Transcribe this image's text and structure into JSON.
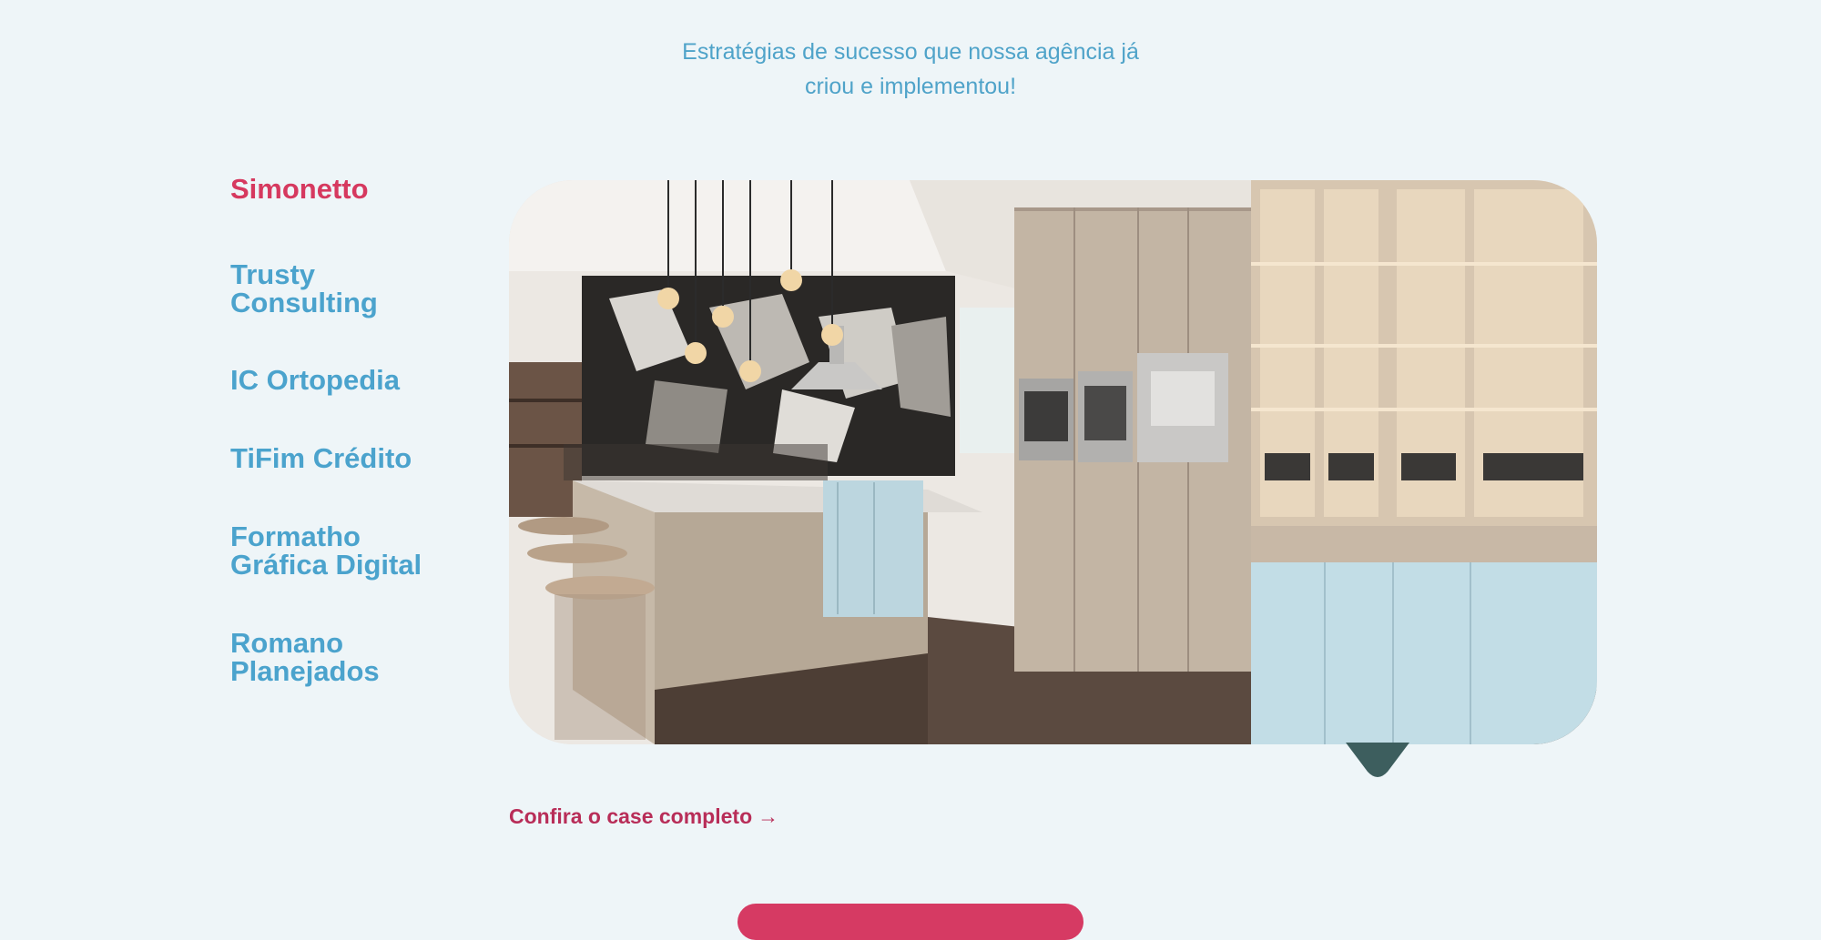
{
  "header": {
    "subtitle_line1": "Estratégias de sucesso que nossa agência já",
    "subtitle_line2": "criou e implementou!"
  },
  "cases": [
    {
      "line1": "Simonetto",
      "line2": "",
      "active": true
    },
    {
      "line1": "Trusty",
      "line2": "Consulting",
      "active": false
    },
    {
      "line1": "IC Ortopedia",
      "line2": "",
      "active": false
    },
    {
      "line1": "TiFim Crédito",
      "line2": "",
      "active": false
    },
    {
      "line1": "Formatho",
      "line2": "Gráfica Digital",
      "active": false
    },
    {
      "line1": "Romano",
      "line2": "Planejados",
      "active": false
    }
  ],
  "cta": {
    "label": "Confira o case completo",
    "arrow": "→"
  },
  "colors": {
    "background": "#eef5f8",
    "accent_blue": "#4ba3cd",
    "accent_pink": "#d6395f",
    "cta": "#b82d58"
  },
  "image": {
    "subject": "kitchen-interior-photo"
  }
}
